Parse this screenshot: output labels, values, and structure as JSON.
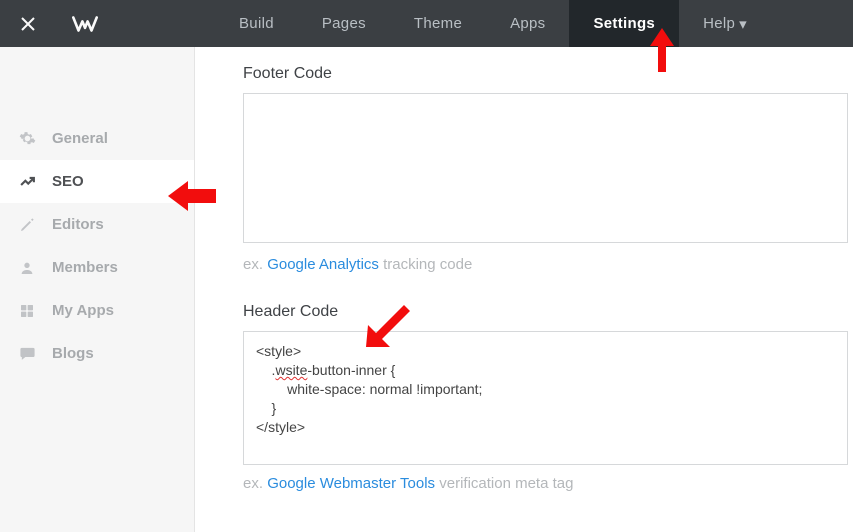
{
  "topnav": {
    "items": [
      {
        "label": "Build"
      },
      {
        "label": "Pages"
      },
      {
        "label": "Theme"
      },
      {
        "label": "Apps"
      },
      {
        "label": "Settings"
      },
      {
        "label": "Help"
      }
    ]
  },
  "sidebar": {
    "items": [
      {
        "label": "General"
      },
      {
        "label": "SEO"
      },
      {
        "label": "Editors"
      },
      {
        "label": "Members"
      },
      {
        "label": "My Apps"
      },
      {
        "label": "Blogs"
      }
    ]
  },
  "sections": {
    "footer": {
      "label": "Footer Code",
      "value": "",
      "hint_prefix": "ex. ",
      "hint_link": "Google Analytics",
      "hint_suffix": " tracking code"
    },
    "header": {
      "label": "Header Code",
      "value": "<style>\n    .wsite-button-inner {\n        white-space: normal !important;\n    }\n</style>",
      "hint_prefix": "ex. ",
      "hint_link": "Google Webmaster Tools",
      "hint_suffix": " verification meta tag"
    }
  }
}
